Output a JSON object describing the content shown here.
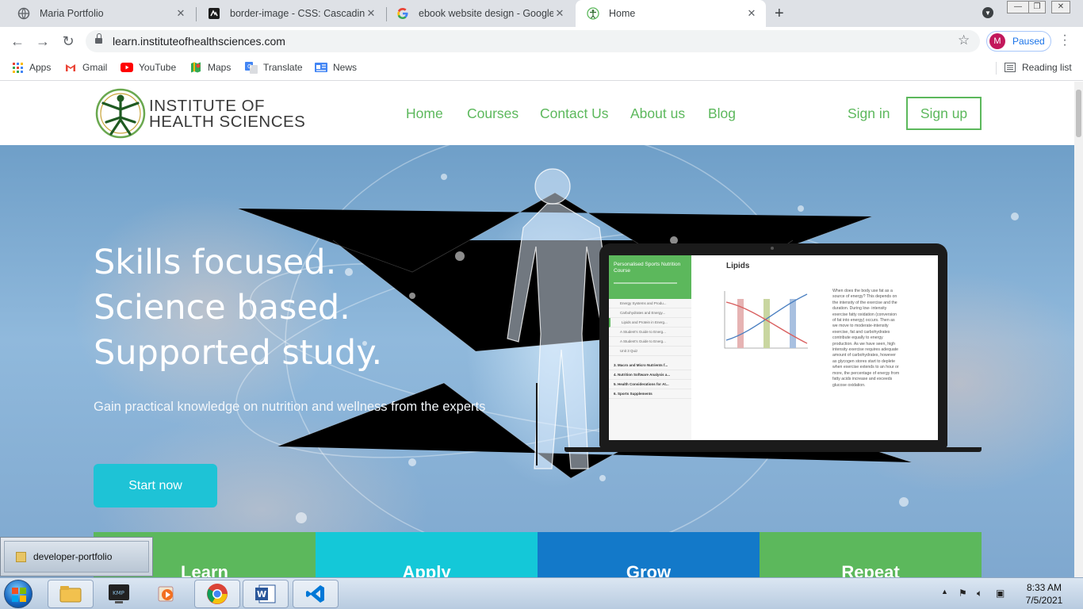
{
  "browser": {
    "tabs": [
      {
        "title": "Maria Portfolio",
        "icon": "globe-icon",
        "active": false
      },
      {
        "title": "border-image - CSS: Cascading Style Sheets | MDN",
        "icon": "mdn-icon",
        "active": false
      },
      {
        "title": "ebook website design - Google Search",
        "icon": "google-icon",
        "active": false
      },
      {
        "title": "Home",
        "icon": "ihs-icon",
        "active": true
      }
    ],
    "url": "learn.instituteofhealthsciences.com",
    "profile_initial": "M",
    "profile_status": "Paused",
    "bookmarks": [
      {
        "label": "Apps",
        "icon": "apps-grid-icon"
      },
      {
        "label": "Gmail",
        "icon": "gmail-icon"
      },
      {
        "label": "YouTube",
        "icon": "youtube-icon"
      },
      {
        "label": "Maps",
        "icon": "maps-icon"
      },
      {
        "label": "Translate",
        "icon": "translate-icon"
      },
      {
        "label": "News",
        "icon": "news-icon"
      }
    ],
    "reading_list": "Reading list"
  },
  "site": {
    "logo_line1": "INSTITUTE OF",
    "logo_line2": "HEALTH SCIENCES",
    "nav": [
      "Home",
      "Courses",
      "Contact Us",
      "About us",
      "Blog"
    ],
    "sign_in": "Sign in",
    "sign_up": "Sign up",
    "accent_color": "#5cb85c"
  },
  "hero": {
    "title_lines": [
      "Skills focused.",
      "Science based.",
      "Supported study."
    ],
    "subtitle": "Gain practical knowledge on nutrition and wellness from the experts",
    "cta": "Start now",
    "cta_color": "#1ec3d6"
  },
  "laptop_screen": {
    "course_title": "Personalised Sports Nutrition Course",
    "lessons": [
      "Energy Systems and Produ...",
      "Carbohydrates and Energy...",
      "Lipids and Protein in Energ...",
      "A Student's Guide to Energ...",
      "A Student's Guide to Energ...",
      "Unit 3 Quiz"
    ],
    "modules": [
      "3. Macro and Micro Nutrients f...",
      "4. Nutrition Software Analysis a...",
      "5. Health Considerations for At...",
      "6. Sports Supplements"
    ],
    "lesson_title": "Lipids",
    "para1": "When does the body use fat as a source of energy? This depends on the intensity of the exercise and the duration. During low- intensity exercise fatty oxidation (conversion of fat into energy) occurs. Then as we move to moderate-intensity exercise, fat and carbohydrates contribute equally to energy production. As we have seen, high intensity exercise requires adequate amount of carbohydrates, however as glycogen stores start to deplete when exercise extends to an hour or more, the percentage of energy from fatty acids increase and exceeds glucose oxidation.",
    "para2": "Before we look at how we convert fat into energy, we need to revise the structure of fat. 'Lipids' is the general name for fat but there are many different subgroups. Lipids are loosely defined as groups of"
  },
  "features": [
    {
      "label": "Learn",
      "color": "#5cb85c"
    },
    {
      "label": "Apply",
      "color": "#14c8d8"
    },
    {
      "label": "Grow",
      "color": "#1379c9"
    },
    {
      "label": "Repeat",
      "color": "#5cb85c"
    }
  ],
  "taskbar": {
    "popup_label": "developer-portfolio",
    "apps": [
      "explorer-icon",
      "kmplayer-icon",
      "media-player-icon",
      "chrome-icon",
      "word-icon",
      "vscode-icon"
    ],
    "time": "8:33 AM",
    "date": "7/5/2021"
  }
}
